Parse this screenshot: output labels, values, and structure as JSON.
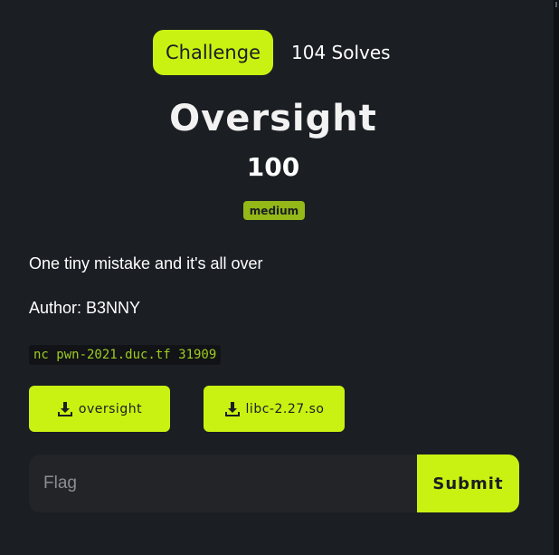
{
  "tabs": {
    "challenge_label": "Challenge",
    "solves_label": "104 Solves"
  },
  "challenge": {
    "name": "Oversight",
    "points": "100",
    "difficulty": "medium",
    "description": "One tiny mistake and it's all over",
    "author": "Author: B3NNY",
    "connection": "nc pwn-2021.duc.tf 31909"
  },
  "files": [
    {
      "label": "oversight",
      "icon": "download-icon"
    },
    {
      "label": "libc-2.27.so",
      "icon": "download-icon"
    }
  ],
  "form": {
    "flag_placeholder": "Flag",
    "flag_value": "",
    "submit_label": "Submit"
  },
  "colors": {
    "accent": "#c9f212",
    "badge": "#93b817",
    "background": "#1b1e23",
    "code_text": "#9fcc1f"
  }
}
